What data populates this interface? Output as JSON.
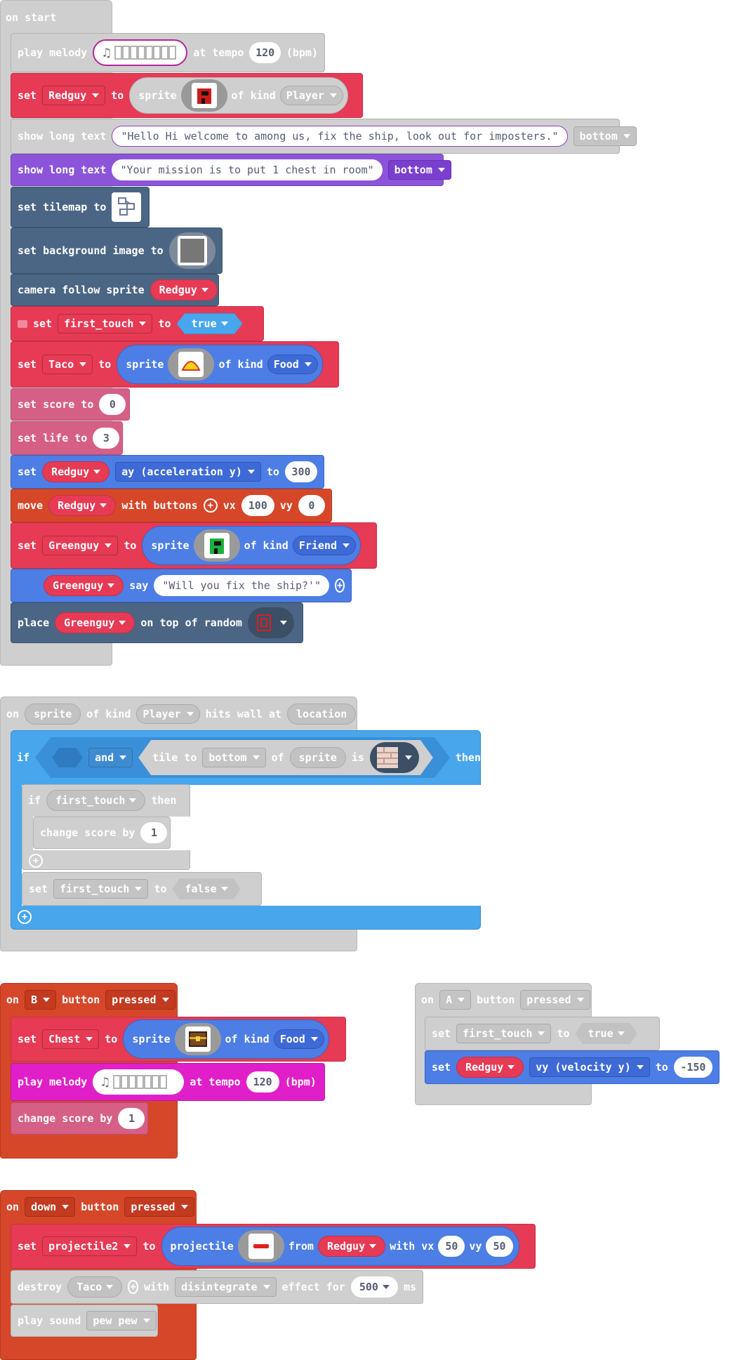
{
  "on_start": {
    "hat": "on start",
    "melody": {
      "label": "play melody",
      "at_tempo": "at tempo",
      "tempo": "120",
      "bpm": "(bpm)"
    },
    "set_redguy": {
      "set": "set",
      "var": "Redguy",
      "to": "to",
      "sprite": "sprite",
      "of_kind": "of kind",
      "kind": "Player"
    },
    "long_text1": {
      "label": "show long text",
      "text": "\"Hello Hi welcome to among us, fix the ship, look out for imposters.\"",
      "pos": "bottom"
    },
    "long_text2": {
      "label": "show long text",
      "text": "\"Your mission is to put 1 chest in room\"",
      "pos": "bottom"
    },
    "tilemap": {
      "label": "set tilemap to"
    },
    "background": {
      "label": "set background image to"
    },
    "camera": {
      "label": "camera follow sprite",
      "sprite": "Redguy"
    },
    "set_first_touch": {
      "set": "set",
      "var": "first_touch",
      "to": "to",
      "value": "true"
    },
    "set_taco": {
      "set": "set",
      "var": "Taco",
      "to": "to",
      "sprite": "sprite",
      "of_kind": "of kind",
      "kind": "Food"
    },
    "score": {
      "label": "set score to",
      "value": "0"
    },
    "life": {
      "label": "set life to",
      "value": "3"
    },
    "accel": {
      "set": "set",
      "sprite": "Redguy",
      "prop": "ay (acceleration y)",
      "to": "to",
      "value": "300"
    },
    "move": {
      "move": "move",
      "sprite": "Redguy",
      "with_buttons": "with buttons",
      "vx_label": "vx",
      "vx": "100",
      "vy_label": "vy",
      "vy": "0"
    },
    "set_greenguy": {
      "set": "set",
      "var": "Greenguy",
      "to": "to",
      "sprite": "sprite",
      "of_kind": "of kind",
      "kind": "Friend"
    },
    "say": {
      "sprite": "Greenguy",
      "say": "say",
      "text": "\"Will you fix the ship?'\""
    },
    "place": {
      "place": "place",
      "sprite": "Greenguy",
      "on_top": "on top of random"
    }
  },
  "hits_wall": {
    "hat": {
      "on": "on",
      "sprite": "sprite",
      "of_kind": "of kind",
      "kind": "Player",
      "hits": "hits wall at",
      "location": "location"
    },
    "if_block": {
      "if": "if",
      "and": "and",
      "tile_to": "tile to",
      "dir": "bottom",
      "of": "of",
      "sprite": "sprite",
      "is": "is",
      "then": "then"
    },
    "inner_if": {
      "if": "if",
      "var": "first_touch",
      "then": "then"
    },
    "change_score": {
      "label": "change score by",
      "value": "1"
    },
    "set_false": {
      "set": "set",
      "var": "first_touch",
      "to": "to",
      "value": "false"
    }
  },
  "b_button": {
    "hat": {
      "on": "on",
      "button": "B",
      "label": "button",
      "event": "pressed"
    },
    "set_chest": {
      "set": "set",
      "var": "Chest",
      "to": "to",
      "sprite": "sprite",
      "of_kind": "of kind",
      "kind": "Food"
    },
    "melody": {
      "label": "play melody",
      "at_tempo": "at tempo",
      "tempo": "120",
      "bpm": "(bpm)"
    },
    "change_score": {
      "label": "change score by",
      "value": "1"
    }
  },
  "a_button": {
    "hat": {
      "on": "on",
      "button": "A",
      "label": "button",
      "event": "pressed"
    },
    "set_first_touch": {
      "set": "set",
      "var": "first_touch",
      "to": "to",
      "value": "true"
    },
    "set_vy": {
      "set": "set",
      "sprite": "Redguy",
      "prop": "vy (velocity y)",
      "to": "to",
      "value": "-150"
    }
  },
  "down_button": {
    "hat": {
      "on": "on",
      "button": "down",
      "label": "button",
      "event": "pressed"
    },
    "projectile": {
      "set": "set",
      "var": "projectile2",
      "to": "to",
      "projectile": "projectile",
      "from": "from",
      "sprite": "Redguy",
      "with_vx": "with vx",
      "vx": "50",
      "vy_label": "vy",
      "vy": "50"
    },
    "destroy": {
      "destroy": "destroy",
      "sprite": "Taco",
      "with": "with",
      "effect": "disintegrate",
      "effect_for": "effect for",
      "ms_value": "500",
      "ms": "ms"
    },
    "sound": {
      "label": "play sound",
      "sound": "pew pew"
    }
  },
  "colors": {
    "red": "#e63a55",
    "blue": "#4d7ee6",
    "slate": "#4b6684",
    "purple": "#8c55d9",
    "pink": "#d65f85",
    "orange": "#d64729",
    "magenta": "#e01fc9",
    "sky": "#47a6ec",
    "disabled": "#cfcfcf"
  }
}
